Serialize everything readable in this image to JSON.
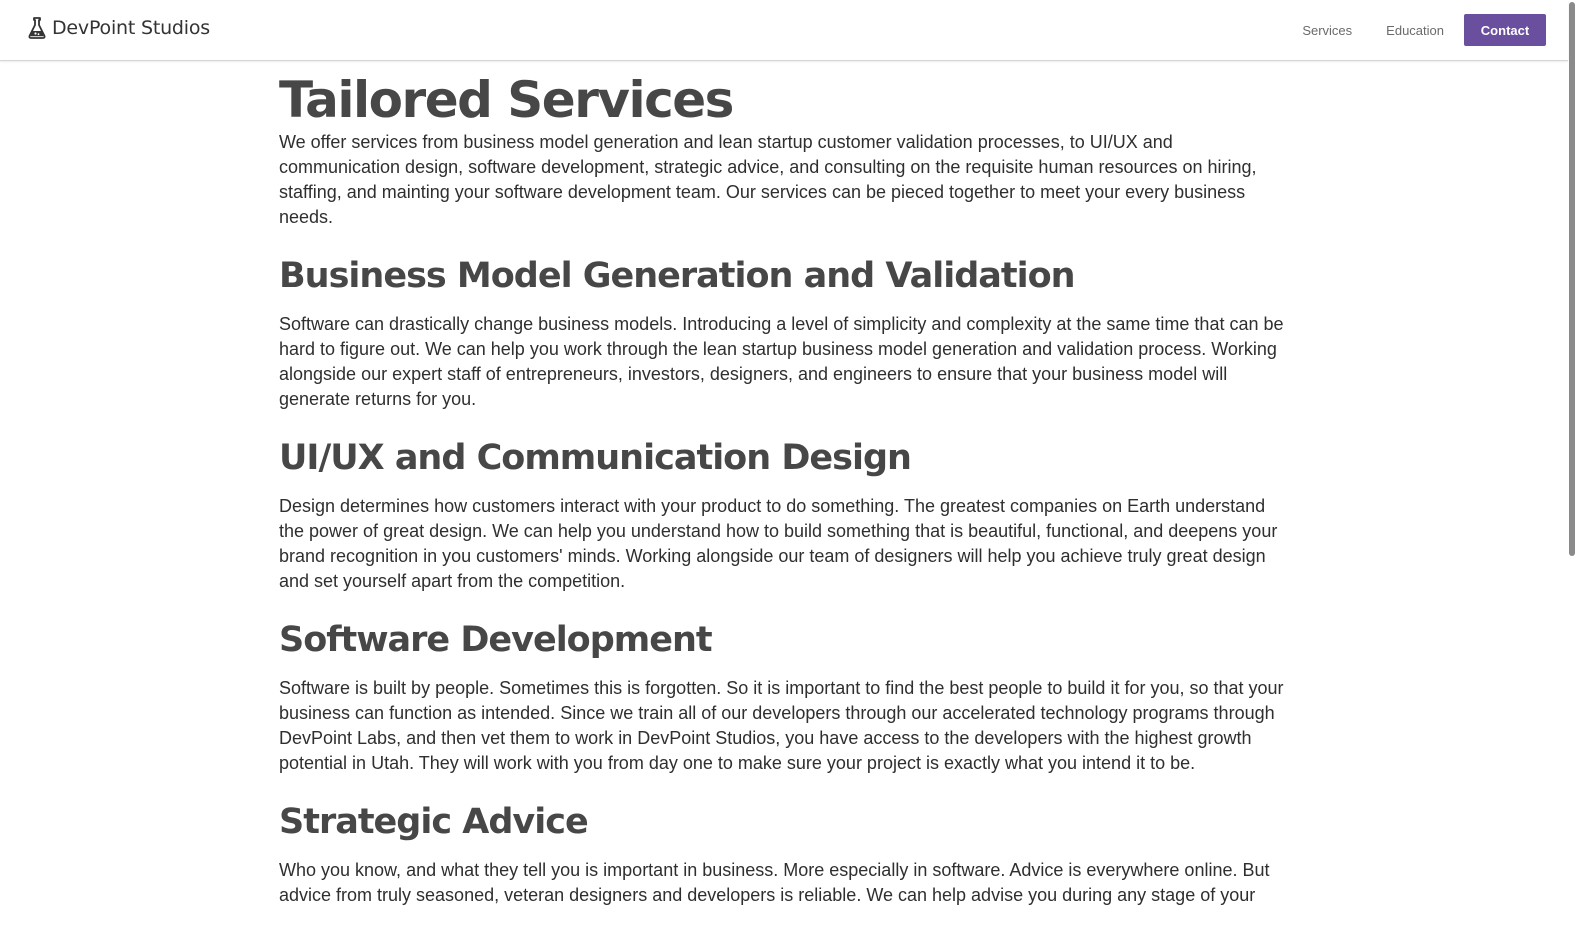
{
  "header": {
    "brand": "DevPoint Studios",
    "brand_icon": "flask-icon",
    "nav": {
      "services": "Services",
      "education": "Education",
      "contact": "Contact"
    },
    "accent_color": "#6a4f9e"
  },
  "main": {
    "title": "Tailored Services",
    "intro": "We offer services from business model generation and lean startup customer validation processes, to UI/UX and communication design, software development, strategic advice, and consulting on the requisite human resources on hiring, staffing, and mainting your software development team. Our services can be pieced together to meet your every business needs.",
    "sections": [
      {
        "heading": "Business Model Generation and Validation",
        "body": "Software can drastically change business models. Introducing a level of simplicity and complexity at the same time that can be hard to figure out. We can help you work through the lean startup business model generation and validation process. Working alongside our expert staff of entrepreneurs, investors, designers, and engineers to ensure that your business model will generate returns for you."
      },
      {
        "heading": "UI/UX and Communication Design",
        "body": "Design determines how customers interact with your product to do something. The greatest companies on Earth understand the power of great design. We can help you understand how to build something that is beautiful, functional, and deepens your brand recognition in you customers' minds. Working alongside our team of designers will help you achieve truly great design and set yourself apart from the competition."
      },
      {
        "heading": "Software Development",
        "body": "Software is built by people. Sometimes this is forgotten. So it is important to find the best people to build it for you, so that your business can function as intended. Since we train all of our developers through our accelerated technology programs through DevPoint Labs, and then vet them to work in DevPoint Studios, you have access to the developers with the highest growth potential in Utah. They will work with you from day one to make sure your project is exactly what you intend it to be."
      },
      {
        "heading": "Strategic Advice",
        "body": "Who you know, and what they tell you is important in business. More especially in software. Advice is everywhere online. But advice from truly seasoned, veteran designers and developers is reliable. We can help advise you during any stage of your"
      }
    ]
  }
}
